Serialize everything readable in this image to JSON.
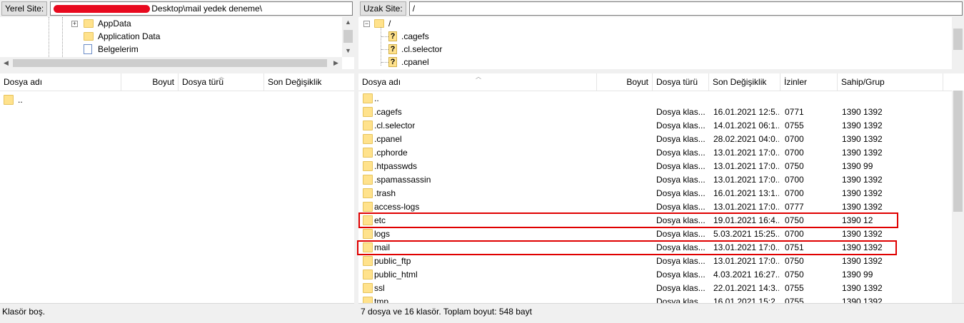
{
  "local": {
    "site_label": "Yerel Site:",
    "path": "Desktop\\mail yedek deneme\\",
    "tree": [
      {
        "label": "AppData",
        "icon": "folder-icon",
        "expander": "+"
      },
      {
        "label": "Application Data",
        "icon": "folder-icon",
        "expander": ""
      },
      {
        "label": "Belgelerim",
        "icon": "document-icon",
        "expander": ""
      }
    ],
    "columns": [
      "Dosya adı",
      "Boyut",
      "Dosya türü",
      "Son Değişiklik"
    ],
    "files": [
      {
        "name": ".."
      }
    ],
    "status": "Klasör boş."
  },
  "remote": {
    "site_label": "Uzak Site:",
    "path": "/",
    "tree": [
      {
        "label": "/",
        "icon": "folder-icon",
        "expander": "−"
      },
      {
        "label": ".cagefs",
        "icon": "unknown-folder-icon"
      },
      {
        "label": ".cl.selector",
        "icon": "unknown-folder-icon"
      },
      {
        "label": ".cpanel",
        "icon": "unknown-folder-icon"
      }
    ],
    "columns": [
      "Dosya adı",
      "Boyut",
      "Dosya türü",
      "Son Değişiklik",
      "İzinler",
      "Sahip/Grup"
    ],
    "files": [
      {
        "name": "..",
        "type": "",
        "modified": "",
        "perms": "",
        "owner": ""
      },
      {
        "name": ".cagefs",
        "type": "Dosya klas...",
        "modified": "16.01.2021 12:5...",
        "perms": "0771",
        "owner": "1390 1392"
      },
      {
        "name": ".cl.selector",
        "type": "Dosya klas...",
        "modified": "14.01.2021 06:1...",
        "perms": "0755",
        "owner": "1390 1392"
      },
      {
        "name": ".cpanel",
        "type": "Dosya klas...",
        "modified": "28.02.2021 04:0...",
        "perms": "0700",
        "owner": "1390 1392"
      },
      {
        "name": ".cphorde",
        "type": "Dosya klas...",
        "modified": "13.01.2021 17:0...",
        "perms": "0700",
        "owner": "1390 1392"
      },
      {
        "name": ".htpasswds",
        "type": "Dosya klas...",
        "modified": "13.01.2021 17:0...",
        "perms": "0750",
        "owner": "1390 99"
      },
      {
        "name": ".spamassassin",
        "type": "Dosya klas...",
        "modified": "13.01.2021 17:0...",
        "perms": "0700",
        "owner": "1390 1392"
      },
      {
        "name": ".trash",
        "type": "Dosya klas...",
        "modified": "16.01.2021 13:1...",
        "perms": "0700",
        "owner": "1390 1392"
      },
      {
        "name": "access-logs",
        "type": "Dosya klas...",
        "modified": "13.01.2021 17:0...",
        "perms": "0777",
        "owner": "1390 1392"
      },
      {
        "name": "etc",
        "type": "Dosya klas...",
        "modified": "19.01.2021 16:4...",
        "perms": "0750",
        "owner": "1390 12"
      },
      {
        "name": "logs",
        "type": "Dosya klas...",
        "modified": "5.03.2021 15:25...",
        "perms": "0700",
        "owner": "1390 1392"
      },
      {
        "name": "mail",
        "type": "Dosya klas...",
        "modified": "13.01.2021 17:0...",
        "perms": "0751",
        "owner": "1390 1392"
      },
      {
        "name": "public_ftp",
        "type": "Dosya klas...",
        "modified": "13.01.2021 17:0...",
        "perms": "0750",
        "owner": "1390 1392"
      },
      {
        "name": "public_html",
        "type": "Dosya klas...",
        "modified": "4.03.2021 16:27...",
        "perms": "0750",
        "owner": "1390 99"
      },
      {
        "name": "ssl",
        "type": "Dosya klas...",
        "modified": "22.01.2021 14:3...",
        "perms": "0755",
        "owner": "1390 1392"
      },
      {
        "name": "tmp",
        "type": "Dosya klas...",
        "modified": "16.01.2021 15:2...",
        "perms": "0755",
        "owner": "1390 1392"
      }
    ],
    "status": "7 dosya ve 16 klasör. Toplam boyut: 548 bayt"
  },
  "highlight_color": "#e00000"
}
